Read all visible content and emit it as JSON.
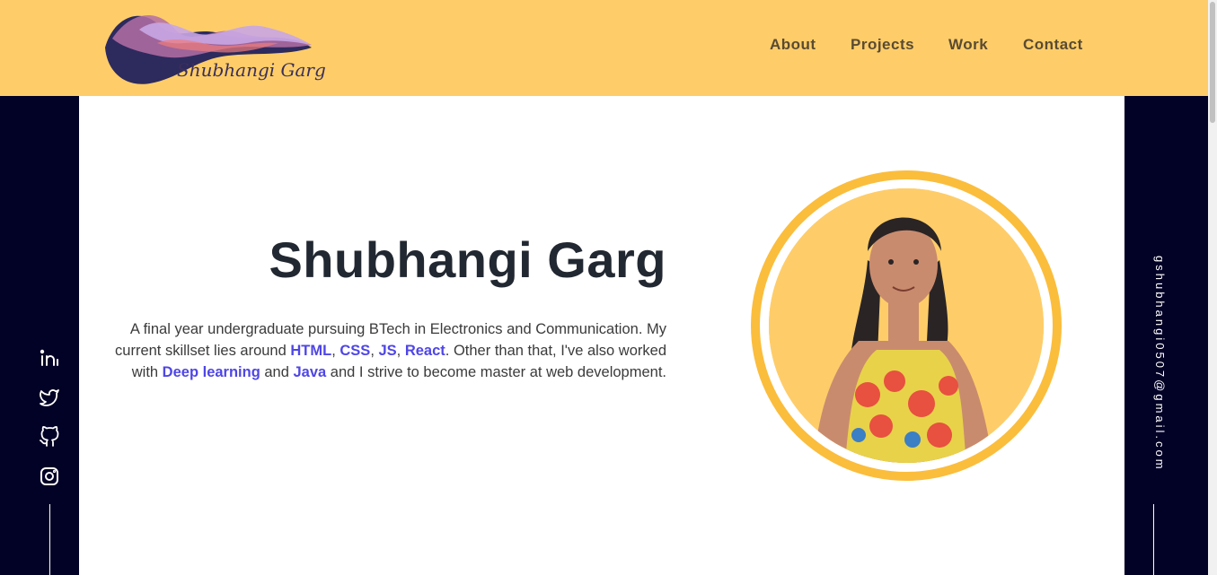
{
  "logo": {
    "text": "Shubhangi Garg"
  },
  "nav": {
    "about": "About",
    "projects": "Projects",
    "work": "Work",
    "contact": "Contact"
  },
  "hero": {
    "name": "Shubhangi Garg",
    "bio": {
      "t1": "A final year undergraduate pursuing BTech in Electronics and Communication. My current skillset lies around ",
      "s1": "HTML",
      "t2": ", ",
      "s2": "CSS",
      "t3": ", ",
      "s3": "JS",
      "t4": ", ",
      "s4": "React",
      "t5": ". Other than that, I've also worked with ",
      "s5": "Deep learning",
      "t6": " and ",
      "s6": "Java",
      "t7": " and I strive to become master at web development."
    }
  },
  "social": [
    "linkedin-icon",
    "twitter-icon",
    "github-icon",
    "instagram-icon"
  ],
  "email": "gshubhangi0507@gmail.com",
  "colors": {
    "header": "#fecd69",
    "rail": "#020126",
    "accent": "#4f46e5",
    "ring": "#fbbd3c"
  }
}
